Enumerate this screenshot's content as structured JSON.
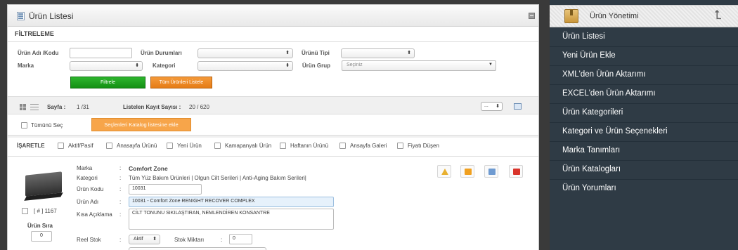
{
  "panel": {
    "title": "Ürün Listesi",
    "filter_section": "FİLTRELEME"
  },
  "filters": {
    "product_name_label": "Ürün Adı /Kodu",
    "product_name_value": "",
    "product_status_label": "Ürün Durumları",
    "product_type_label": "Ürünü Tipi",
    "brand_label": "Marka",
    "category_label": "Kategori",
    "product_group_label": "Ürün Grup",
    "product_group_placeholder": "Seçiniz",
    "filter_button": "Filtrele",
    "list_all_button": "Tüm Ürünleri Listele"
  },
  "pager": {
    "page_label": "Sayfa :",
    "page_value": "1 /31",
    "records_label": "Listelen Kayıt Sayısı :",
    "records_value": "20 / 620",
    "per_page_value": "..."
  },
  "selection": {
    "select_all": "Tümünü Seç",
    "add_to_catalog": "Seçlenleri Katalog listesine ekle"
  },
  "marks": {
    "label": "İŞARETLE",
    "options": [
      "Aktif/Pasif",
      "Anasayfa Ürünü",
      "Yeni Ürün",
      "Kamapanyalı Ürün",
      "Haftanın Ürünü",
      "Ansayfa Galeri",
      "Fiyatı Düşen"
    ]
  },
  "product": {
    "id_text": "[ # ] 1167",
    "order_label": "Ürün Sıra",
    "order_value": "0",
    "brand_label": "Marka",
    "brand_value": "Comfort Zone",
    "category_label": "Kategori",
    "category_value": "Tüm Yüz Bakım Ürünleri | Olgun Cilt Serileri | Anti-Aging Bakım Serileri|",
    "code_label": "Ürün Kodu",
    "code_value": "10031",
    "name_label": "Ürün Adı",
    "name_value": "10031 - Comfort Zone  RENIGHT RECOVER COMPLEX",
    "desc_label": "Kısa Açıklama",
    "desc_value": "CİLT TONUNU SIKILAŞTIRAN, NEMLENDİREN KONSANTRE",
    "stock_label": "Reel Stok",
    "stock_value": "Aktif",
    "stock_qty_label": "Stok Miktarı",
    "stock_qty_value": "0",
    "colon": ":"
  },
  "sidebar": {
    "title": "Ürün Yönetimi",
    "items": [
      "Ürün Listesi",
      "Yeni Ürün Ekle",
      "XML'den Ürün Aktarımı",
      "EXCEL'den Ürün Aktarımı",
      "Ürün Kategorileri",
      "Kategori ve Ürün Seçenekleri",
      "Marka Tanımları",
      "Ürün Katalogları",
      "Ürün Yorumları"
    ]
  },
  "icons": {
    "panel_icon": "list-icon",
    "collapse": "collapse-icon",
    "grid_view": "grid-view-icon",
    "list_view": "list-view-icon",
    "export": "export-icon",
    "sidebar_header": "box-icon",
    "back": "back-arrow-icon"
  },
  "colors": {
    "filter_button": "#1e9f1e",
    "list_all_button": "#ef8a22",
    "catalog_button": "#f7a54a",
    "sidebar_bg": "#2f3b45"
  }
}
